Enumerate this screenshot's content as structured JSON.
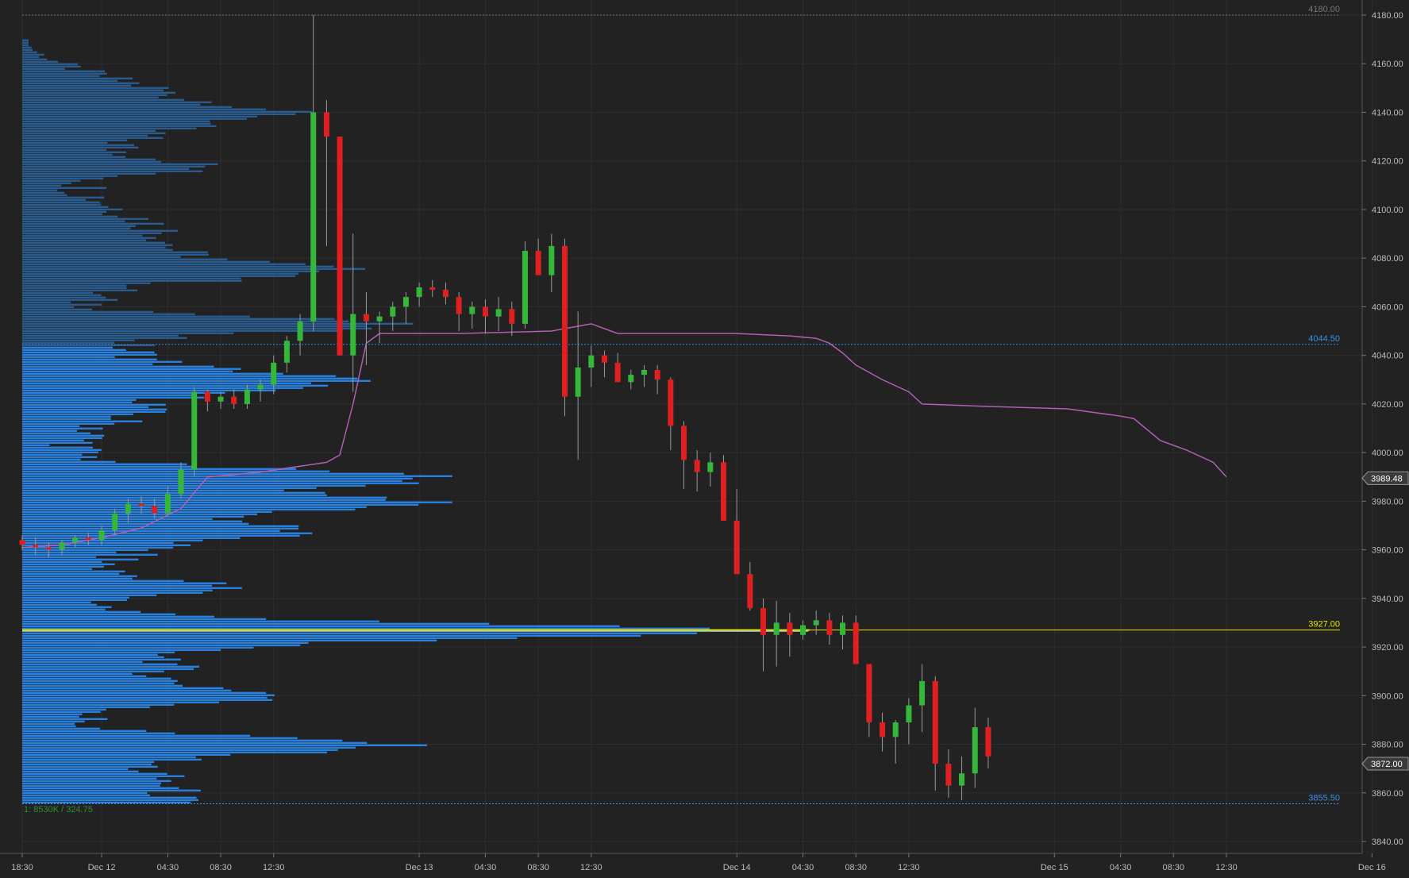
{
  "chart_data": {
    "type": "candlestick",
    "ylim": [
      3835,
      4182
    ],
    "y_ticks": [
      4180,
      4160,
      4140,
      4120,
      4100,
      4080,
      4060,
      4040,
      4020,
      4000,
      3980,
      3960,
      3940,
      3920,
      3900,
      3880,
      3860,
      3840
    ],
    "y_tick_labels": [
      "4180.00",
      "4160.00",
      "4140.00",
      "4120.00",
      "4100.00",
      "4080.00",
      "4060.00",
      "4040.00",
      "4020.00",
      "4000.00",
      "3980.00",
      "3960.00",
      "3940.00",
      "3920.00",
      "3900.00",
      "3880.00",
      "3860.00",
      "3840.00"
    ],
    "x_labels": [
      {
        "text": "18:30",
        "bar": 0
      },
      {
        "text": "Dec 12",
        "bar": 6
      },
      {
        "text": "04:30",
        "bar": 11
      },
      {
        "text": "08:30",
        "bar": 15
      },
      {
        "text": "12:30",
        "bar": 19
      },
      {
        "text": "Dec 13",
        "bar": 30
      },
      {
        "text": "04:30",
        "bar": 35
      },
      {
        "text": "08:30",
        "bar": 39
      },
      {
        "text": "12:30",
        "bar": 43
      },
      {
        "text": "Dec 14",
        "bar": 54
      },
      {
        "text": "04:30",
        "bar": 59
      },
      {
        "text": "08:30",
        "bar": 63
      },
      {
        "text": "12:30",
        "bar": 67
      },
      {
        "text": "Dec 15",
        "bar": 78
      },
      {
        "text": "04:30",
        "bar": 83
      },
      {
        "text": "08:30",
        "bar": 87
      },
      {
        "text": "12:30",
        "bar": 91
      },
      {
        "text": "Dec 16",
        "bar": 102
      },
      {
        "text": "04:30",
        "bar": 107
      },
      {
        "text": "08:30",
        "bar": 111
      },
      {
        "text": "12:30",
        "bar": 115
      }
    ],
    "candles": [
      [
        3964,
        3966,
        3960,
        3962
      ],
      [
        3962,
        3965,
        3958,
        3961
      ],
      [
        3961,
        3963,
        3957,
        3960
      ],
      [
        3960,
        3964,
        3958,
        3963
      ],
      [
        3963,
        3966,
        3961,
        3965
      ],
      [
        3965,
        3967,
        3962,
        3964
      ],
      [
        3964,
        3970,
        3962,
        3968
      ],
      [
        3968,
        3977,
        3966,
        3975
      ],
      [
        3975,
        3981,
        3971,
        3979
      ],
      [
        3979,
        3982,
        3975,
        3978
      ],
      [
        3978,
        3981,
        3973,
        3975
      ],
      [
        3975,
        3986,
        3974,
        3983
      ],
      [
        3983,
        3996,
        3981,
        3993
      ],
      [
        3993,
        4027,
        3990,
        4025
      ],
      [
        4025,
        4026,
        4017,
        4021
      ],
      [
        4021,
        4025,
        4018,
        4023
      ],
      [
        4023,
        4026,
        4018,
        4020
      ],
      [
        4020,
        4028,
        4018,
        4026
      ],
      [
        4026,
        4030,
        4021,
        4028
      ],
      [
        4028,
        4040,
        4024,
        4037
      ],
      [
        4037,
        4048,
        4033,
        4046
      ],
      [
        4046,
        4057,
        4040,
        4054
      ],
      [
        4054,
        4180,
        4050,
        4140
      ],
      [
        4140,
        4145,
        4085,
        4130
      ],
      [
        4130,
        4110,
        4040,
        4040
      ],
      [
        4040,
        4090,
        4025,
        4057
      ],
      [
        4057,
        4066,
        4036,
        4054
      ],
      [
        4054,
        4058,
        4045,
        4056
      ],
      [
        4056,
        4062,
        4050,
        4060
      ],
      [
        4060,
        4066,
        4053,
        4064
      ],
      [
        4064,
        4070,
        4060,
        4068
      ],
      [
        4068,
        4071,
        4064,
        4067
      ],
      [
        4067,
        4070,
        4061,
        4064
      ],
      [
        4064,
        4066,
        4050,
        4057
      ],
      [
        4057,
        4062,
        4051,
        4060
      ],
      [
        4060,
        4063,
        4049,
        4056
      ],
      [
        4056,
        4064,
        4050,
        4059
      ],
      [
        4059,
        4062,
        4048,
        4053
      ],
      [
        4053,
        4087,
        4051,
        4083
      ],
      [
        4083,
        4088,
        4075,
        4073
      ],
      [
        4073,
        4090,
        4066,
        4085
      ],
      [
        4085,
        4088,
        4015,
        4023
      ],
      [
        4023,
        4058,
        3997,
        4035
      ],
      [
        4035,
        4044,
        4027,
        4040
      ],
      [
        4040,
        4042,
        4031,
        4037
      ],
      [
        4037,
        4041,
        4030,
        4029
      ],
      [
        4029,
        4034,
        4026,
        4032
      ],
      [
        4032,
        4036,
        4027,
        4034
      ],
      [
        4034,
        4036,
        4024,
        4030
      ],
      [
        4030,
        4031,
        4001,
        4011
      ],
      [
        4011,
        4013,
        3985,
        3997
      ],
      [
        3997,
        4001,
        3984,
        3992
      ],
      [
        3992,
        4000,
        3986,
        3996
      ],
      [
        3996,
        3999,
        3972,
        3972
      ],
      [
        3972,
        3985,
        3955,
        3950
      ],
      [
        3950,
        3955,
        3935,
        3936
      ],
      [
        3936,
        3940,
        3910,
        3925
      ],
      [
        3925,
        3939,
        3912,
        3930
      ],
      [
        3930,
        3934,
        3916,
        3925
      ],
      [
        3925,
        3931,
        3923,
        3929
      ],
      [
        3929,
        3935,
        3925,
        3931
      ],
      [
        3931,
        3934,
        3921,
        3925
      ],
      [
        3925,
        3933,
        3919,
        3930
      ],
      [
        3930,
        3933,
        3920,
        3913
      ],
      [
        3913,
        3910,
        3883,
        3889
      ],
      [
        3889,
        3893,
        3877,
        3883
      ],
      [
        3883,
        3890,
        3872,
        3889
      ],
      [
        3889,
        3899,
        3880,
        3896
      ],
      [
        3896,
        3913,
        3885,
        3906
      ],
      [
        3906,
        3908,
        3861,
        3872
      ],
      [
        3872,
        3878,
        3858,
        3863
      ],
      [
        3863,
        3875,
        3857,
        3868
      ],
      [
        3868,
        3895,
        3862,
        3887
      ],
      [
        3887,
        3891,
        3870,
        3875
      ]
    ],
    "vwap": [
      [
        0,
        3961
      ],
      [
        3,
        3962
      ],
      [
        6,
        3965
      ],
      [
        9,
        3969
      ],
      [
        12,
        3977
      ],
      [
        14,
        3990
      ],
      [
        18,
        3992
      ],
      [
        23,
        3996
      ],
      [
        24,
        3999
      ],
      [
        25,
        4020
      ],
      [
        26,
        4045
      ],
      [
        27,
        4049
      ],
      [
        33,
        4049
      ],
      [
        40,
        4050
      ],
      [
        43,
        4053
      ],
      [
        45,
        4049
      ],
      [
        54,
        4049
      ],
      [
        58,
        4048
      ],
      [
        60,
        4047
      ],
      [
        61,
        4045
      ],
      [
        62,
        4041
      ],
      [
        63,
        4036
      ],
      [
        65,
        4030
      ],
      [
        67,
        4025
      ],
      [
        68,
        4020
      ],
      [
        73,
        4019
      ],
      [
        79,
        4018
      ],
      [
        83,
        4015
      ],
      [
        84,
        4014
      ],
      [
        86,
        4005
      ],
      [
        88,
        4001
      ],
      [
        90,
        3996
      ],
      [
        91,
        3990
      ]
    ],
    "price_lines": [
      {
        "value": 4180,
        "label": "4180.00",
        "color": "#777777"
      },
      {
        "value": 4044.5,
        "label": "4044.50",
        "color": "#3a8fe8"
      },
      {
        "value": 3927,
        "label": "3927.00",
        "color": "#e6e600"
      },
      {
        "value": 3855.5,
        "label": "3855.50",
        "color": "#3a8fe8"
      }
    ],
    "axis_badges": [
      {
        "value": 3989.48,
        "label": "3989.48"
      },
      {
        "value": 3872.0,
        "label": "3872.00"
      }
    ],
    "volume_profile": {
      "poc": 3927,
      "value_area_high": 4044.5,
      "value_area_low": 3855.5,
      "summary": "1: 8530K / 324.75"
    },
    "colors": {
      "background": "#222222",
      "grid": "#2e2e2e",
      "up": "#35b83a",
      "down": "#e02020",
      "profile_value_area": "#2a86e8",
      "profile_outside": "#2a5f96",
      "vwap": "#b05fb5",
      "poc": "#e6e600",
      "axis_text": "#bbbbbb",
      "summary_text": "#2f8f2f"
    }
  }
}
